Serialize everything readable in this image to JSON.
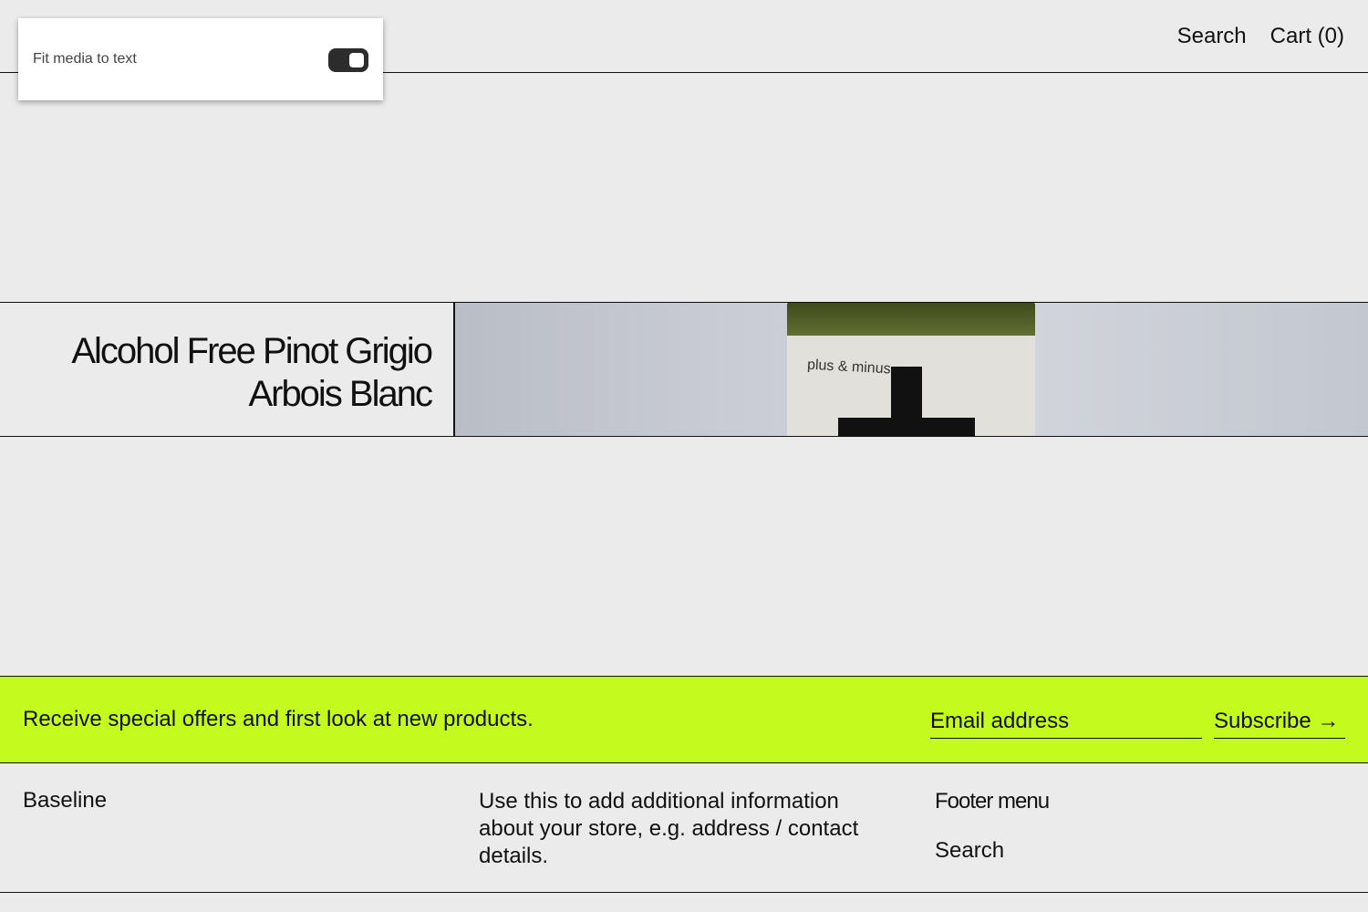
{
  "editor_panel": {
    "label": "Fit media to text",
    "toggle_on": true
  },
  "header": {
    "nav": {
      "search": "Search",
      "cart": "Cart (0)"
    }
  },
  "feature": {
    "title": "Alcohol Free Pinot Grigio\nArbois Blanc",
    "image_label": "plus & minus"
  },
  "newsletter": {
    "text": "Receive special offers and first look at new products.",
    "email_placeholder": "Email address",
    "email_value": "",
    "subscribe_label": "Subscribe →",
    "background_color": "#c5fa1e"
  },
  "footer": {
    "brand": "Baseline",
    "info": "Use this to add additional information about your store, e.g. address / contact details.",
    "menu_title": "Footer menu",
    "menu_items": [
      "Search"
    ]
  }
}
